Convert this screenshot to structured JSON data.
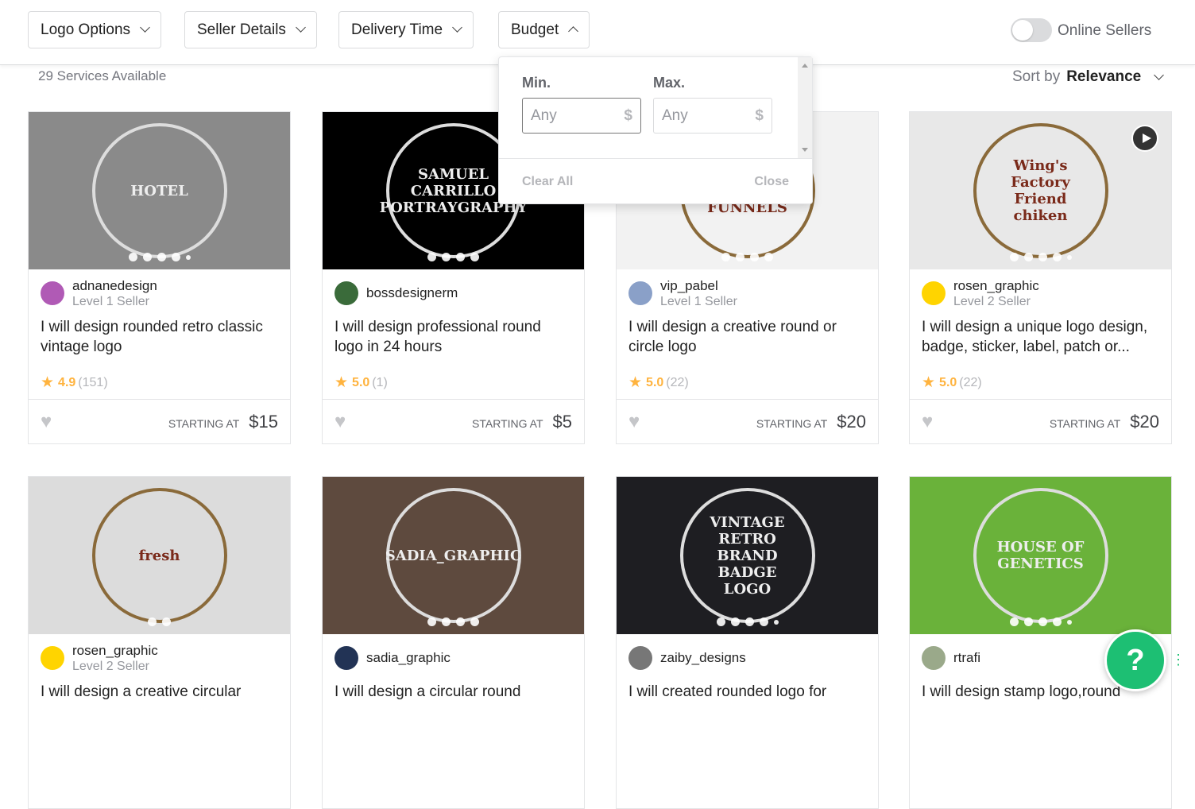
{
  "filters": [
    {
      "label": "Logo Options",
      "icon": "chevron-down-icon"
    },
    {
      "label": "Seller Details",
      "icon": "chevron-down-icon"
    },
    {
      "label": "Delivery Time",
      "icon": "chevron-down-icon"
    },
    {
      "label": "Budget",
      "icon": "chevron-up-icon"
    }
  ],
  "online_sellers": {
    "label": "Online Sellers",
    "on": false
  },
  "services_count": "29 Services Available",
  "sort": {
    "label": "Sort by",
    "value": "Relevance"
  },
  "budget": {
    "min_label": "Min.",
    "max_label": "Max.",
    "min_placeholder": "Any",
    "max_placeholder": "Any",
    "currency": "$",
    "clear": "Clear All",
    "close": "Close"
  },
  "price_label": "STARTING AT",
  "gigs": [
    {
      "seller": "adnanedesign",
      "level": "Level 1 Seller",
      "title": "I will design rounded retro classic vintage logo",
      "rating": "4.9",
      "reviews": "(151)",
      "price": "$15",
      "bg": "#8a8a8a",
      "lettering": "HOTEL",
      "dots": 5,
      "avatar_bg": "#b05ab5"
    },
    {
      "seller": "bossdesignerm",
      "level": "",
      "title": "I will design professional round logo in 24 hours",
      "rating": "5.0",
      "reviews": "(1)",
      "price": "$5",
      "bg": "#000000",
      "lettering": "SAMUEL CARRILLO PORTRAYGRAPHY",
      "dots": 4,
      "avatar_bg": "#3a6b3a"
    },
    {
      "seller": "vip_pabel",
      "level": "Level 1 Seller",
      "title": "I will design a creative round or circle logo",
      "rating": "5.0",
      "reviews": "(22)",
      "price": "$20",
      "bg": "#f2f2f2",
      "lettering": "EST-2018 SALES FUNNELS",
      "dots": 4,
      "avatar_bg": "#8aa0c8"
    },
    {
      "seller": "rosen_graphic",
      "level": "Level 2 Seller",
      "title": "I will design a unique logo design, badge, sticker, label, patch or...",
      "rating": "5.0",
      "reviews": "(22)",
      "price": "$20",
      "bg": "#e8e8e8",
      "lettering": "Wing's Factory Friend chiken",
      "dots": 5,
      "avatar_bg": "#ffd400",
      "play": true
    },
    {
      "seller": "rosen_graphic",
      "level": "Level 2 Seller",
      "title": "I will design a creative circular",
      "rating": "",
      "reviews": "",
      "price": "",
      "bg": "#dcdcdc",
      "lettering": "fresh",
      "dots": 2,
      "avatar_bg": "#ffd400"
    },
    {
      "seller": "sadia_graphic",
      "level": "",
      "title": "I will design a circular round",
      "rating": "",
      "reviews": "",
      "price": "",
      "bg": "#5e4a3e",
      "lettering": "SADIA_GRAPHIC",
      "dots": 4,
      "avatar_bg": "#223355",
      "online": true
    },
    {
      "seller": "zaiby_designs",
      "level": "",
      "title": "I will created rounded logo for",
      "rating": "",
      "reviews": "",
      "price": "",
      "bg": "#1e1e22",
      "lettering": "VINTAGE RETRO BRAND BADGE LOGO",
      "dots": 5,
      "avatar_bg": "#777777"
    },
    {
      "seller": "rtrafi",
      "level": "",
      "title": "I will design stamp logo,round",
      "rating": "",
      "reviews": "",
      "price": "",
      "bg": "#6ab23a",
      "lettering": "HOUSE OF GENETICS",
      "dots": 5,
      "avatar_bg": "#9aa98a"
    }
  ],
  "help": {
    "label": "?"
  }
}
